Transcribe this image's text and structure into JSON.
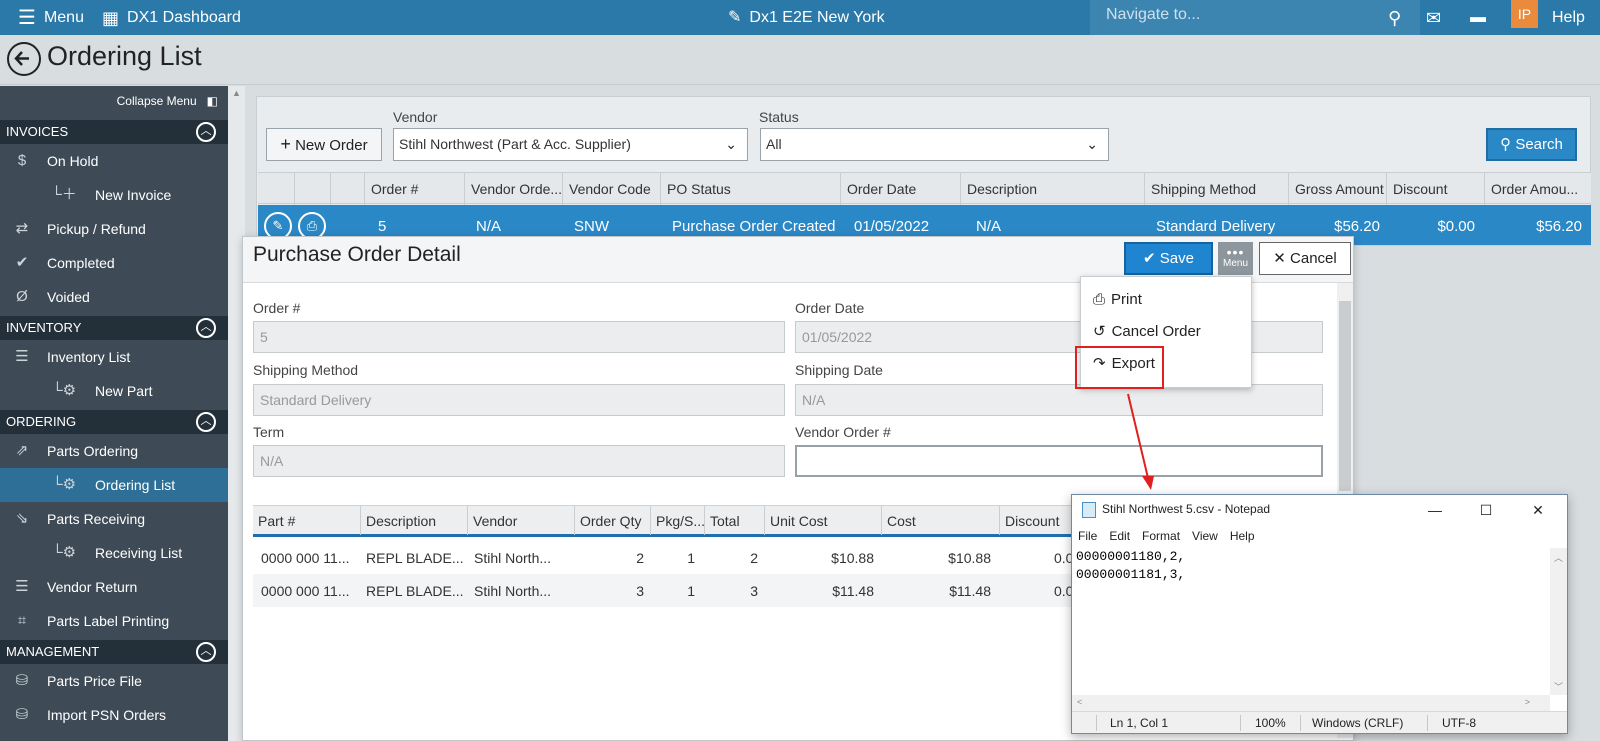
{
  "topbar": {
    "menu_label": "Menu",
    "dashboard_label": "DX1 Dashboard",
    "store_label": "Dx1 E2E New York",
    "nav_placeholder": "Navigate to...",
    "user_initials": "IP",
    "help_label": "Help"
  },
  "page": {
    "title": "Ordering List"
  },
  "sidebar": {
    "collapse_label": "Collapse Menu",
    "sections": {
      "invoices": "INVOICES",
      "inventory": "INVENTORY",
      "ordering": "ORDERING",
      "management": "MANAGEMENT"
    },
    "items": {
      "on_hold": "On Hold",
      "new_invoice": "New Invoice",
      "pickup_refund": "Pickup / Refund",
      "completed": "Completed",
      "voided": "Voided",
      "inventory_list": "Inventory List",
      "new_part": "New Part",
      "parts_ordering": "Parts Ordering",
      "ordering_list": "Ordering List",
      "parts_receiving": "Parts Receiving",
      "receiving_list": "Receiving List",
      "vendor_return": "Vendor Return",
      "parts_label_printing": "Parts Label Printing",
      "parts_price_file": "Parts Price File",
      "import_psn_orders": "Import PSN Orders"
    }
  },
  "filters": {
    "new_order_label": "New Order",
    "vendor_label": "Vendor",
    "vendor_value": "Stihl Northwest (Part & Acc. Supplier)",
    "status_label": "Status",
    "status_value": "All",
    "search_label": "Search"
  },
  "orders_grid": {
    "columns": [
      "Order #",
      "Vendor Orde...",
      "Vendor Code",
      "PO Status",
      "Order Date",
      "Description",
      "Shipping Method",
      "Gross Amount",
      "Discount",
      "Order Amou..."
    ],
    "row": {
      "order_no": "5",
      "vendor_order": "N/A",
      "vendor_code": "SNW",
      "po_status": "Purchase Order Created",
      "order_date": "01/05/2022",
      "description": "N/A",
      "shipping_method": "Standard Delivery",
      "gross_amount": "$56.20",
      "discount": "$0.00",
      "order_amount": "$56.20"
    }
  },
  "modal": {
    "title": "Purchase Order Detail",
    "save_label": "Save",
    "menu_label": "Menu",
    "cancel_label": "Cancel",
    "fields": {
      "order_no_label": "Order #",
      "order_no_value": "5",
      "order_date_label": "Order Date",
      "order_date_value": "01/05/2022",
      "shipping_method_label": "Shipping Method",
      "shipping_method_value": "Standard Delivery",
      "shipping_date_label": "Shipping Date",
      "shipping_date_value": "N/A",
      "term_label": "Term",
      "term_value": "N/A",
      "vendor_order_label": "Vendor Order #",
      "vendor_order_value": ""
    },
    "dropdown": {
      "print": "Print",
      "cancel_order": "Cancel Order",
      "export": "Export"
    },
    "parts": {
      "columns": [
        "Part #",
        "Description",
        "Vendor",
        "Order Qty",
        "Pkg/S...",
        "Total",
        "Unit Cost",
        "Cost",
        "Discount"
      ],
      "rows": [
        {
          "part": "0000 000 11...",
          "description": "REPL BLADE...",
          "vendor": "Stihl North...",
          "qty": "2",
          "pkg": "1",
          "total": "2",
          "unit_cost": "$10.88",
          "cost": "$10.88",
          "discount": "0.0"
        },
        {
          "part": "0000 000 11...",
          "description": "REPL BLADE...",
          "vendor": "Stihl North...",
          "qty": "3",
          "pkg": "1",
          "total": "3",
          "unit_cost": "$11.48",
          "cost": "$11.48",
          "discount": "0.0"
        }
      ]
    }
  },
  "notepad": {
    "title": "Stihl Northwest 5.csv - Notepad",
    "menu": [
      "File",
      "Edit",
      "Format",
      "View",
      "Help"
    ],
    "content": "00000001180,2,\n00000001181,3,",
    "status": {
      "position": "Ln 1, Col 1",
      "zoom": "100%",
      "line_endings": "Windows (CRLF)",
      "encoding": "UTF-8"
    }
  },
  "colors": {
    "topbar": "#2b79a8",
    "sidebar": "#3e4b56",
    "accent": "#2b88c6",
    "highlight": "#e02020"
  }
}
